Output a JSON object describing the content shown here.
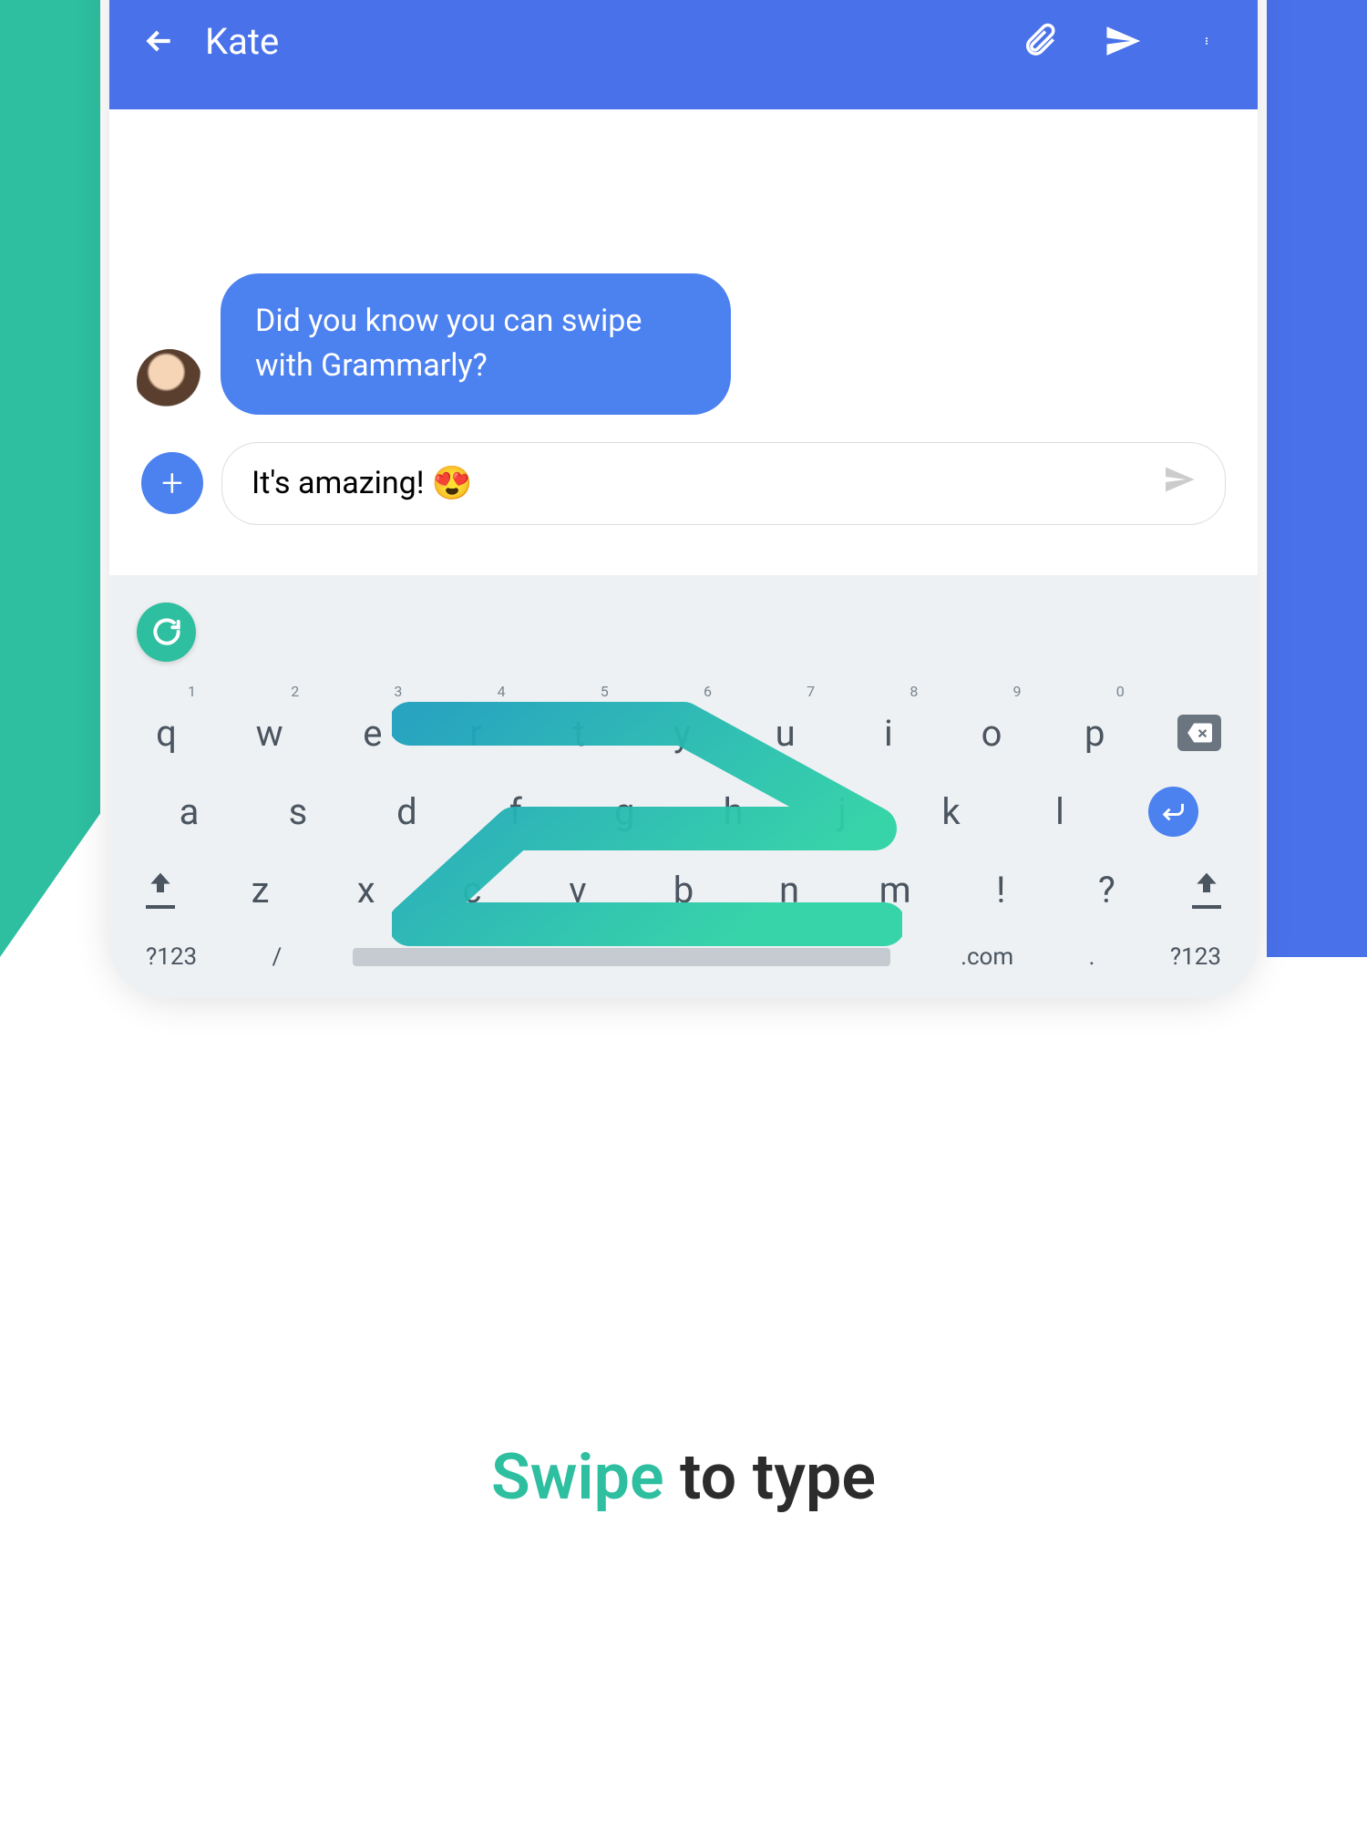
{
  "header": {
    "contact_name": "Kate"
  },
  "chat": {
    "message": "Did you know you can swipe with Grammarly?",
    "input_text": "It's amazing!",
    "input_emoji": "😍"
  },
  "keyboard": {
    "row1": [
      {
        "key": "q",
        "num": "1"
      },
      {
        "key": "w",
        "num": "2"
      },
      {
        "key": "e",
        "num": "3"
      },
      {
        "key": "r",
        "num": "4"
      },
      {
        "key": "t",
        "num": "5"
      },
      {
        "key": "y",
        "num": "6"
      },
      {
        "key": "u",
        "num": "7"
      },
      {
        "key": "i",
        "num": "8"
      },
      {
        "key": "o",
        "num": "9"
      },
      {
        "key": "p",
        "num": "0"
      }
    ],
    "row2": [
      "a",
      "s",
      "d",
      "f",
      "g",
      "h",
      "j",
      "k",
      "l"
    ],
    "row3": [
      "z",
      "x",
      "c",
      "v",
      "b",
      "n",
      "m",
      "!",
      "?"
    ],
    "bottom": {
      "sym_left": "?123",
      "slash": "/",
      "dotcom": ".com",
      "period": ".",
      "sym_right": "?123"
    }
  },
  "tagline": {
    "swipe": "Swipe",
    "rest": " to type"
  },
  "colors": {
    "blue": "#4971e9",
    "green": "#2ebea0",
    "bubble": "#4c81f0"
  }
}
